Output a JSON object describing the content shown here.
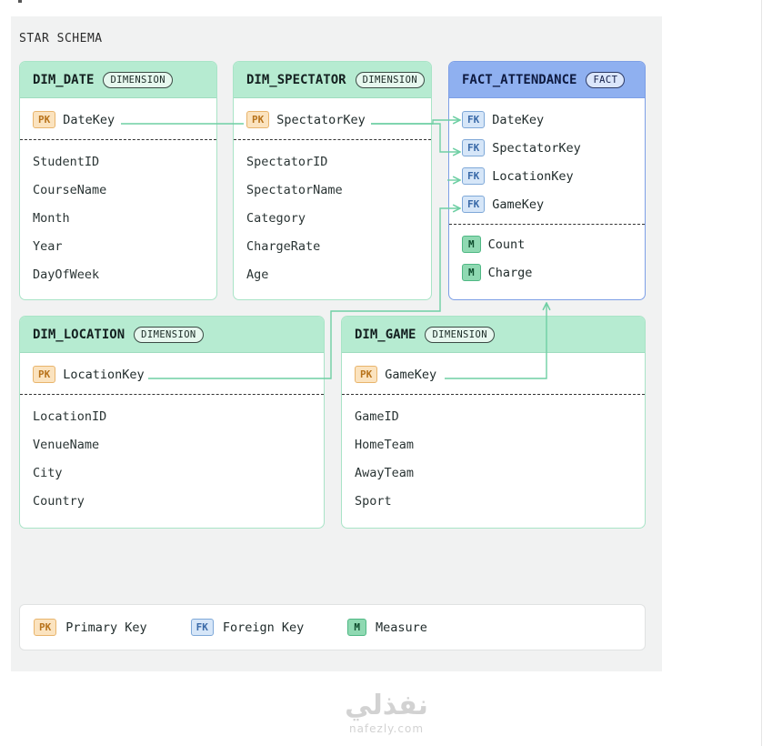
{
  "title": "STAR SCHEMA",
  "colors": {
    "dimension_header": "#b6ebd1",
    "fact_header": "#8fb0f0",
    "pk_tag": "#fbe3bf",
    "fk_tag": "#d6e6f8",
    "measure_tag": "#8fd9b2",
    "connector": "#6fcfa4"
  },
  "tables": {
    "dim_date": {
      "name": "DIM_DATE",
      "badge": "DIMENSION",
      "keys": [
        {
          "tag": "PK",
          "label": "DateKey"
        }
      ],
      "attributes": [
        "StudentID",
        "CourseName",
        "Month",
        "Year",
        "DayOfWeek"
      ]
    },
    "dim_spectator": {
      "name": "DIM_SPECTATOR",
      "badge": "DIMENSION",
      "keys": [
        {
          "tag": "PK",
          "label": "SpectatorKey"
        }
      ],
      "attributes": [
        "SpectatorID",
        "SpectatorName",
        "Category",
        "ChargeRate",
        "Age"
      ]
    },
    "fact_attendance": {
      "name": "FACT_ATTENDANCE",
      "badge": "FACT",
      "keys": [
        {
          "tag": "FK",
          "label": "DateKey"
        },
        {
          "tag": "FK",
          "label": "SpectatorKey"
        },
        {
          "tag": "FK",
          "label": "LocationKey"
        },
        {
          "tag": "FK",
          "label": "GameKey"
        }
      ],
      "measures": [
        {
          "tag": "M",
          "label": "Count"
        },
        {
          "tag": "M",
          "label": "Charge"
        }
      ]
    },
    "dim_location": {
      "name": "DIM_LOCATION",
      "badge": "DIMENSION",
      "keys": [
        {
          "tag": "PK",
          "label": "LocationKey"
        }
      ],
      "attributes": [
        "LocationID",
        "VenueName",
        "City",
        "Country"
      ]
    },
    "dim_game": {
      "name": "DIM_GAME",
      "badge": "DIMENSION",
      "keys": [
        {
          "tag": "PK",
          "label": "GameKey"
        }
      ],
      "attributes": [
        "GameID",
        "HomeTeam",
        "AwayTeam",
        "Sport"
      ]
    }
  },
  "relationships": [
    {
      "from": "DIM_DATE.DateKey",
      "to": "FACT_ATTENDANCE.DateKey"
    },
    {
      "from": "DIM_SPECTATOR.SpectatorKey",
      "to": "FACT_ATTENDANCE.SpectatorKey"
    },
    {
      "from": "DIM_LOCATION.LocationKey",
      "to": "FACT_ATTENDANCE.GameKey"
    },
    {
      "from": "DIM_GAME.GameKey",
      "to": "FACT_ATTENDANCE"
    }
  ],
  "legend": [
    {
      "tag": "PK",
      "label": "Primary Key"
    },
    {
      "tag": "FK",
      "label": "Foreign Key"
    },
    {
      "tag": "M",
      "label": "Measure"
    }
  ],
  "watermark": {
    "logo": "نفذلي",
    "url": "nafezly.com"
  }
}
